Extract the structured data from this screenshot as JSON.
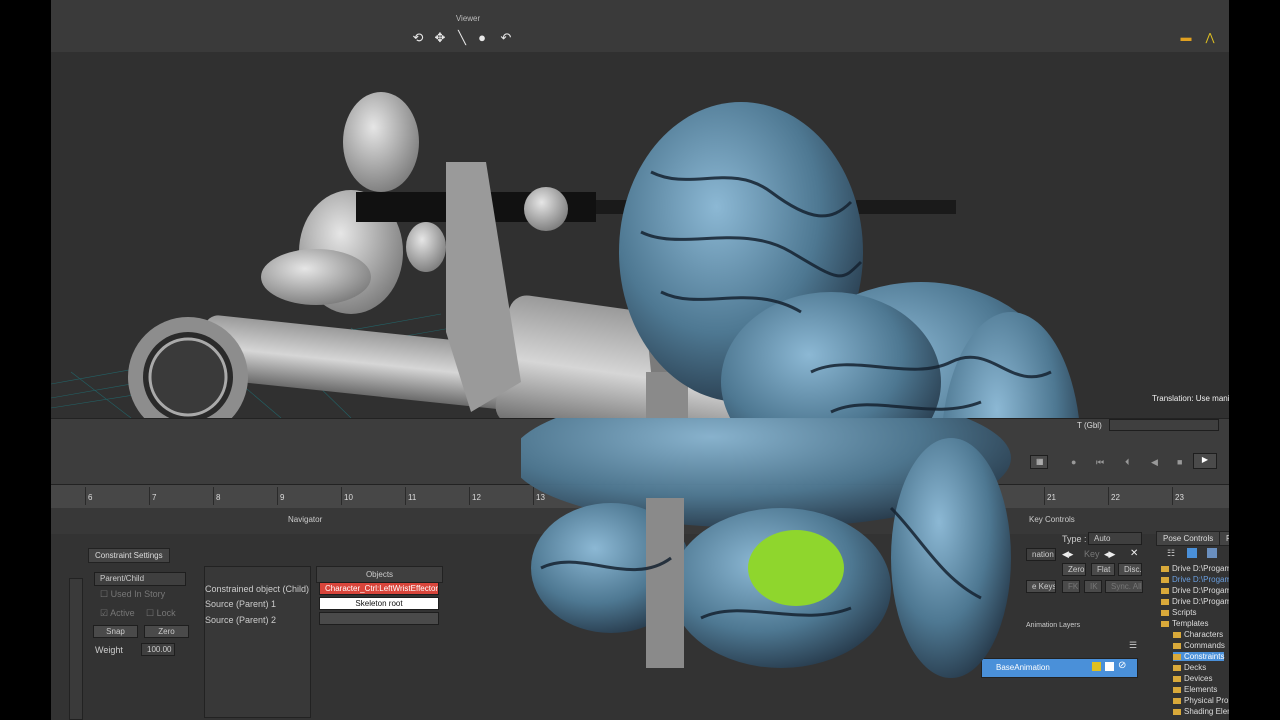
{
  "viewer": {
    "title": "Viewer",
    "tools": [
      "orbit-icon",
      "move-icon",
      "line-icon",
      "pin-icon",
      "undo-arc-icon"
    ],
    "status_text": "Translation: Use manip",
    "axis_mode": "T (Gbl)"
  },
  "timeline": {
    "ticks": [
      "6",
      "7",
      "8",
      "9",
      "10",
      "11",
      "12",
      "13",
      "21",
      "22",
      "23"
    ]
  },
  "navigator": {
    "title": "Navigator"
  },
  "key_controls": {
    "title": "Key Controls",
    "type_label": "Type :",
    "type_value": "Auto",
    "animation_label": "nimation",
    "row2_value": "nation",
    "key_label": "Key",
    "zero": "Zero",
    "flat": "Flat",
    "disc": "Disc.",
    "keys_label": "e Keys",
    "fk": "FK",
    "ik": "IK",
    "sync": "Sync. All",
    "layers_title": "Animation Layers",
    "layer_name": "BaseAnimation"
  },
  "constraint": {
    "tab": "Constraint Settings",
    "type": "Parent/Child",
    "used_in_story": "Used In Story",
    "active": "Active",
    "lock": "Lock",
    "snap": "Snap",
    "zero": "Zero",
    "weight_label": "Weight",
    "weight_value": "100.00",
    "objects_header": "Objects",
    "rows": [
      {
        "label": "Constrained object (Child)",
        "value": "Character_Ctrl:LeftWristEffector"
      },
      {
        "label": "Source (Parent) 1",
        "value": "Skeleton root"
      },
      {
        "label": "Source (Parent) 2",
        "value": ""
      }
    ]
  },
  "resources": {
    "tabs": [
      "Pose Controls",
      "R"
    ],
    "items": [
      "Drive D:\\Progam",
      "Drive D:\\Progam",
      "Drive D:\\Progam",
      "Drive D:\\Progam",
      "Scripts",
      "Templates",
      "Characters",
      "Commands",
      "Constraints",
      "Decks",
      "Devices",
      "Elements",
      "Physical Prop",
      "Shading Elem"
    ],
    "selected_index": 8
  },
  "colors": {
    "accent": "#4a90d9",
    "constrained": "#d9453b",
    "green": "#8fd62d"
  }
}
